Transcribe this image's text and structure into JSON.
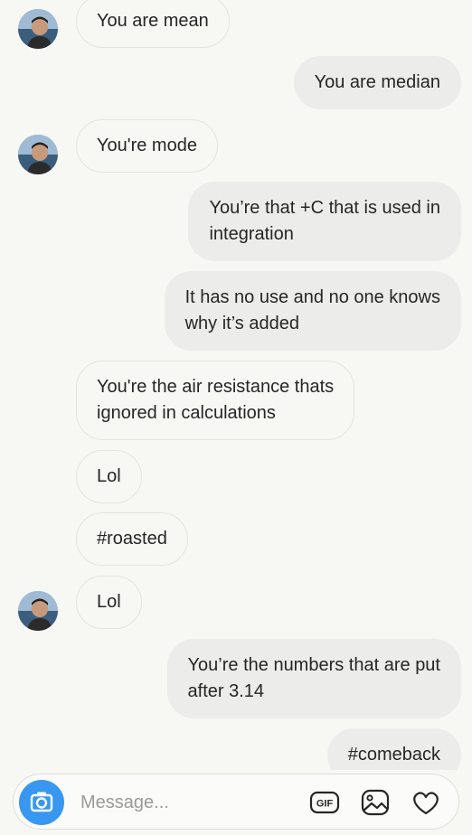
{
  "messages": [
    {
      "from": "them",
      "text": "You are mean",
      "avatar": true
    },
    {
      "from": "me",
      "text": "You are median"
    },
    {
      "from": "them",
      "text": "You're mode",
      "avatar": true
    },
    {
      "from": "me",
      "text": "You’re that +C that is used in\nintegration"
    },
    {
      "from": "me",
      "text": "It has no use and no one knows\nwhy it’s added"
    },
    {
      "from": "them",
      "text": "You're the air resistance thats\nignored in calculations"
    },
    {
      "from": "them",
      "text": "Lol"
    },
    {
      "from": "them",
      "text": "#roasted"
    },
    {
      "from": "them",
      "text": "Lol",
      "avatar": true
    },
    {
      "from": "me",
      "text": "You’re the numbers that are put\nafter 3.14"
    },
    {
      "from": "me",
      "text": "#comeback"
    }
  ],
  "composer": {
    "placeholder": "Message...",
    "gif_label": "GIF",
    "camera_icon": "camera-icon",
    "gallery_icon": "image-icon",
    "like_icon": "heart-icon"
  },
  "colors": {
    "accent": "#3897f0",
    "incoming_bubble_border": "#e3e4e0",
    "outgoing_bubble": "#ececeb",
    "background": "#f7f8f4"
  }
}
